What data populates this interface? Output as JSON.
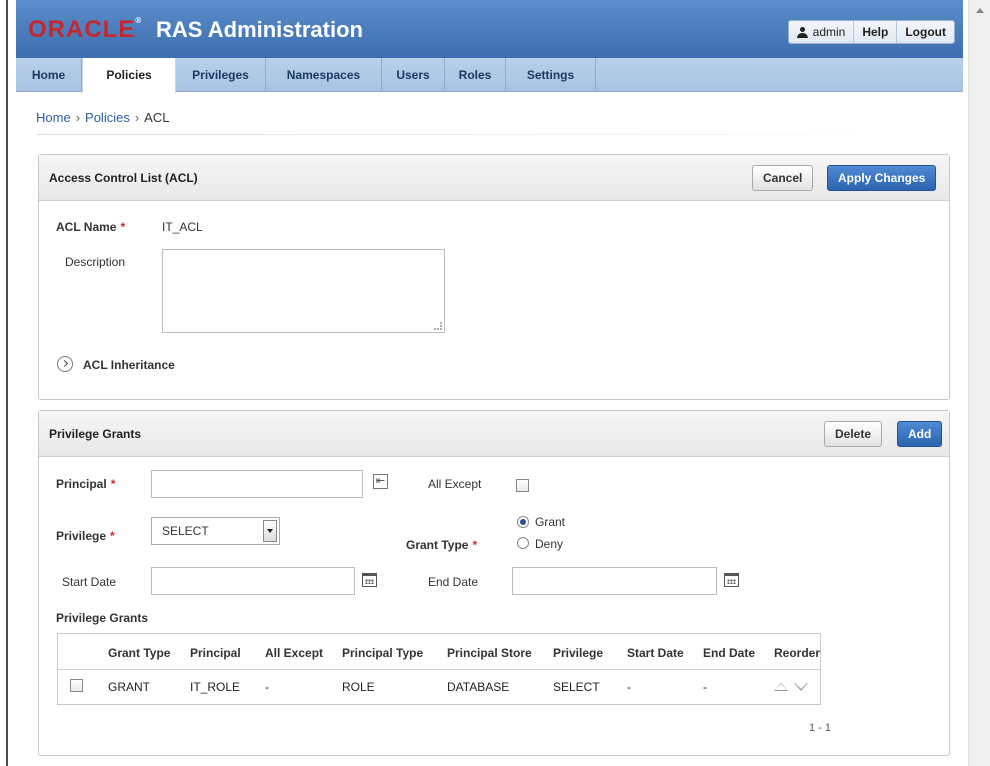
{
  "header": {
    "logo": "ORACLE",
    "logo_mark": "®",
    "app_title": "RAS Administration",
    "user": "admin",
    "help": "Help",
    "logout": "Logout"
  },
  "tabs": [
    {
      "label": "Home"
    },
    {
      "label": "Policies"
    },
    {
      "label": "Privileges"
    },
    {
      "label": "Namespaces"
    },
    {
      "label": "Users"
    },
    {
      "label": "Roles"
    },
    {
      "label": "Settings"
    }
  ],
  "breadcrumb": {
    "home": "Home",
    "policies": "Policies",
    "current": "ACL",
    "sep": "›"
  },
  "acl_region": {
    "title": "Access Control List (ACL)",
    "cancel": "Cancel",
    "apply": "Apply Changes",
    "acl_name_label": "ACL Name",
    "acl_name_value": "IT_ACL",
    "description_label": "Description",
    "description_value": "",
    "inheritance_label": "ACL Inheritance"
  },
  "grants_region": {
    "title": "Privilege Grants",
    "delete": "Delete",
    "add": "Add",
    "principal_label": "Principal",
    "principal_value": "",
    "all_except_label": "All Except",
    "privilege_label": "Privilege",
    "privilege_value": "SELECT",
    "grant_type_label": "Grant Type",
    "grant_option": "Grant",
    "deny_option": "Deny",
    "start_date_label": "Start Date",
    "end_date_label": "End Date",
    "report_title": "Privilege Grants",
    "columns": [
      "Grant Type",
      "Principal",
      "All Except",
      "Principal Type",
      "Principal Store",
      "Privilege",
      "Start Date",
      "End Date",
      "Reorder"
    ],
    "rows": [
      {
        "grant_type": "GRANT",
        "principal": "IT_ROLE",
        "all_except": "-",
        "principal_type": "ROLE",
        "principal_store": "DATABASE",
        "privilege": "SELECT",
        "start_date": "-",
        "end_date": "-"
      }
    ],
    "pagination": "1 - 1"
  }
}
